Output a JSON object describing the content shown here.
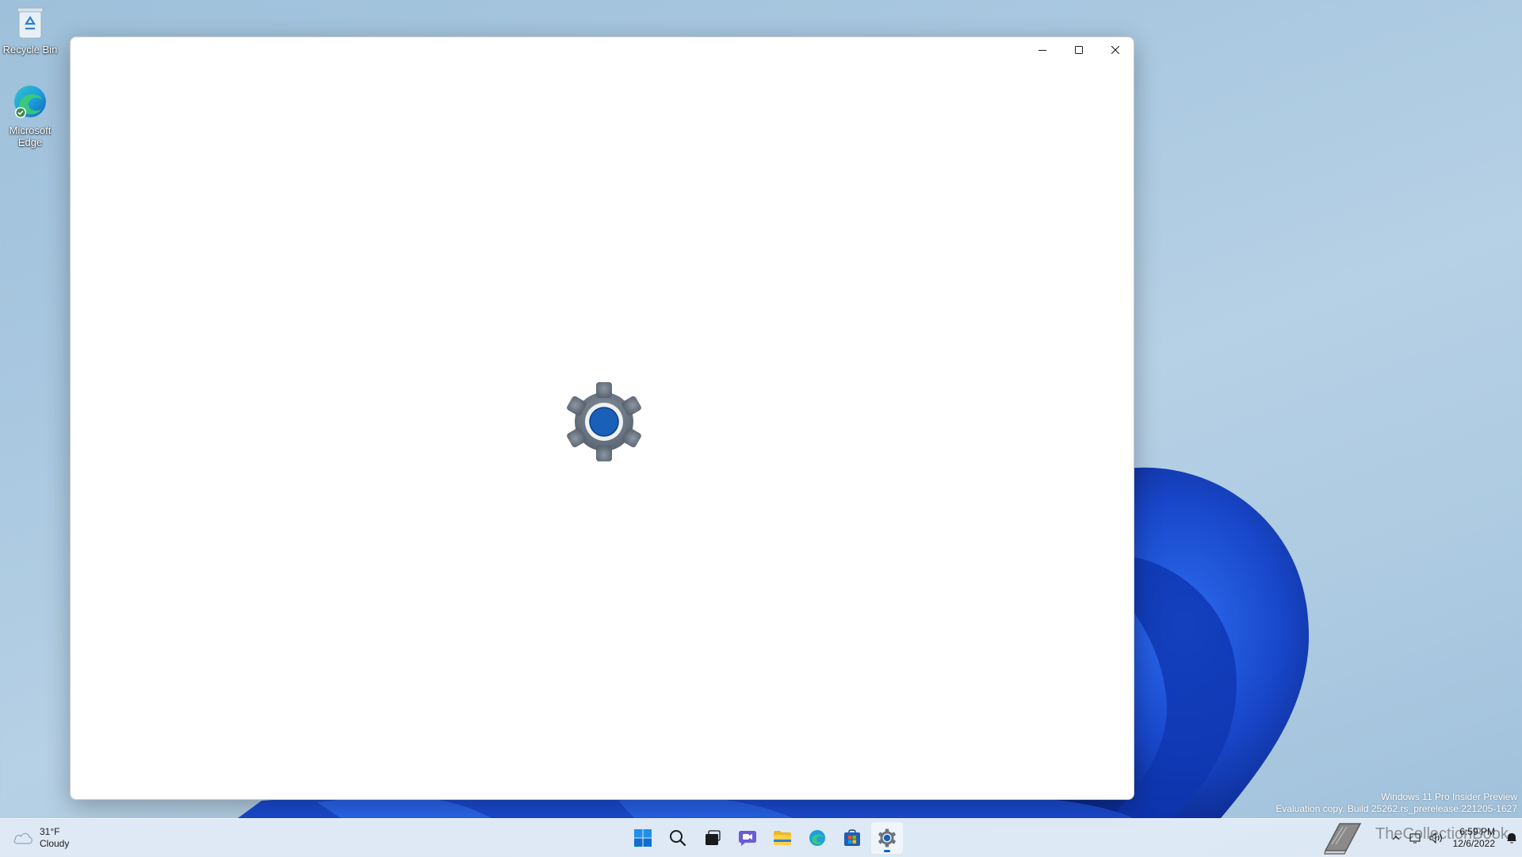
{
  "desktop": {
    "icons": [
      {
        "label": "Recycle Bin",
        "icon": "recycle-bin-icon"
      },
      {
        "label": "Microsoft Edge",
        "icon": "edge-icon"
      }
    ]
  },
  "window": {
    "app": "Settings",
    "state": "loading",
    "controls": {
      "minimize": "minimize-icon",
      "maximize": "maximize-icon",
      "close": "close-icon"
    }
  },
  "watermark": {
    "line1": "Windows 11 Pro Insider Preview",
    "line2": "Evaluation copy. Build 25262.rs_prerelease.221205-1627"
  },
  "taskbar": {
    "weather": {
      "temp": "31°F",
      "condition": "Cloudy"
    },
    "apps": [
      "start",
      "search",
      "task-view",
      "chat",
      "file-explorer",
      "edge",
      "store",
      "settings"
    ],
    "active_app": "settings",
    "tray_overlay_text": "TheCollectionBook",
    "clock": {
      "time": "6:59 PM",
      "date": "12/6/2022"
    }
  },
  "colors": {
    "accent": "#0067c0",
    "wallpaper_bloom": "#1947c6"
  }
}
